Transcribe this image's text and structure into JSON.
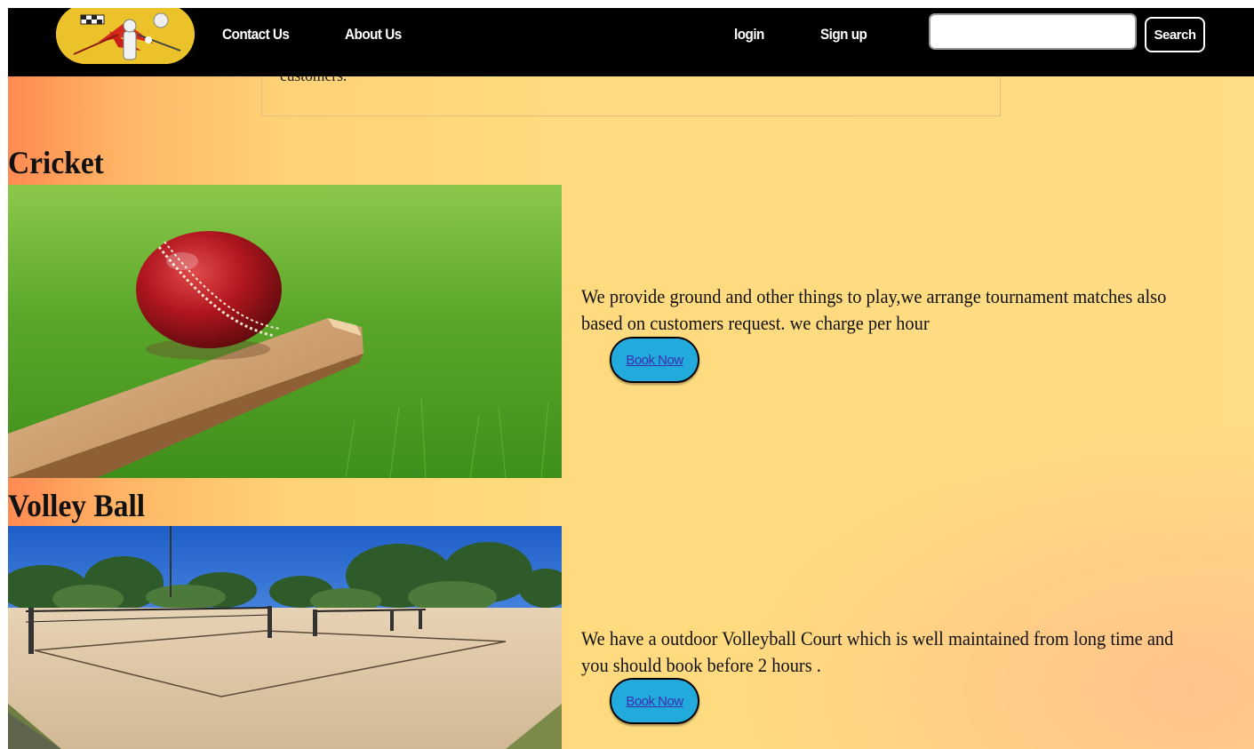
{
  "nav": {
    "links": [
      "Contact Us",
      "About Us"
    ],
    "auth": [
      "login",
      "Sign up"
    ],
    "search_placeholder": "",
    "search_button": "Search"
  },
  "about": {
    "text_tail": "customers."
  },
  "sections": [
    {
      "title": "Cricket",
      "description": "We provide ground and other things to play,we arrange tournament matches also based on customers request. we charge per hour",
      "button": "Book Now",
      "image": "cricket-ball-on-bat-image"
    },
    {
      "title": "Volley Ball",
      "description": "We have a outdoor Volleyball Court which is well maintained from long time and you should book before 2 hours .",
      "button": "Book Now",
      "image": "beach-volleyball-court-image"
    }
  ],
  "colors": {
    "navbar": "#000000",
    "logo_bg": "#ecc22a",
    "page_gradient_left": "#ff8a52",
    "page_gradient_right": "#ffdc85",
    "book_button": "#22aadd",
    "book_link": "#3b2fb0"
  }
}
